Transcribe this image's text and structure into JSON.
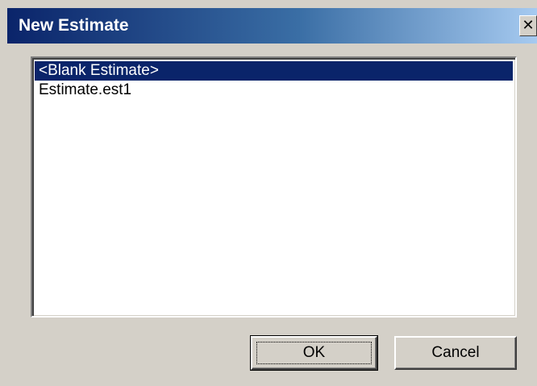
{
  "window": {
    "title": "New Estimate",
    "close_glyph": "✕"
  },
  "list": {
    "items": [
      {
        "label": "<Blank Estimate>",
        "selected": true
      },
      {
        "label": "Estimate.est1",
        "selected": false
      }
    ]
  },
  "buttons": {
    "ok_label": "OK",
    "cancel_label": "Cancel"
  },
  "colors": {
    "title_bar_start": "#0a246a",
    "title_bar_end": "#a6caf0",
    "selection": "#0a246a",
    "face": "#d4d0c8"
  }
}
